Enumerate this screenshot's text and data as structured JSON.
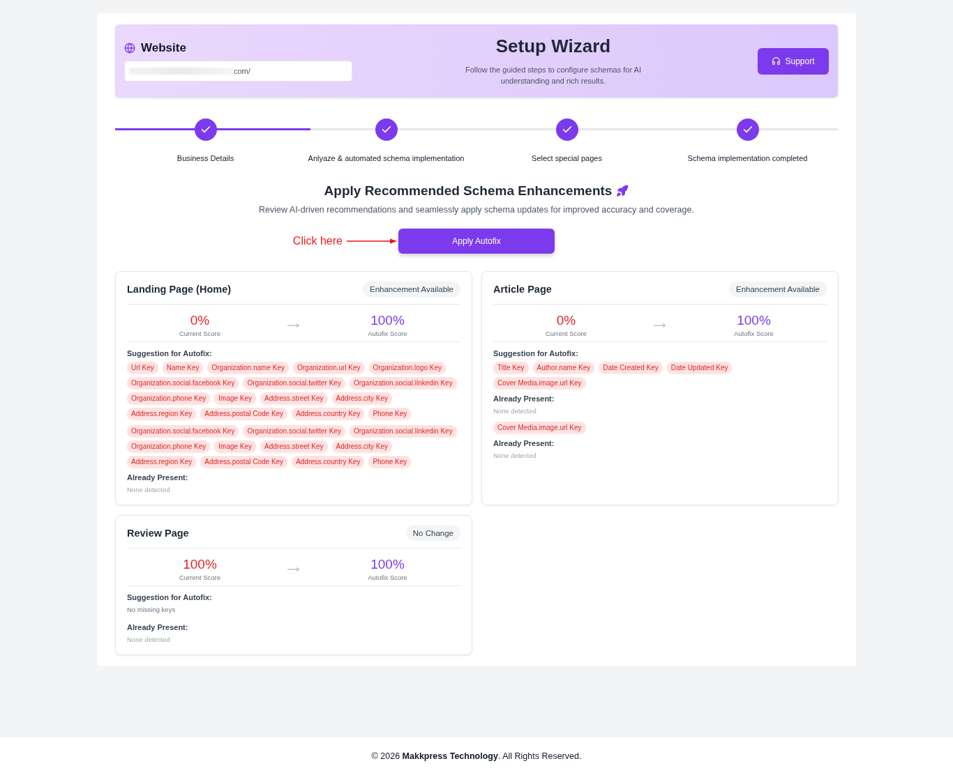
{
  "header": {
    "website_label": "Website",
    "website_value": "com/",
    "title": "Setup Wizard",
    "subtitle": "Follow the guided steps to configure schemas for AI understanding and rich results.",
    "support_button": "Support"
  },
  "progress": {
    "level": 0.27
  },
  "steps": [
    {
      "label": "Business Details",
      "done": true
    },
    {
      "label": "Anlyaze & automated schema implementation",
      "done": true
    },
    {
      "label": "Select special pages",
      "done": true
    },
    {
      "label": "Schema implementation completed",
      "done": true
    }
  ],
  "intro": {
    "title": "Apply Recommended Schema Enhancements",
    "text": "Review AI-driven recommendations and seamlessly apply schema updates for improved accuracy and coverage.",
    "annotation": "Click here",
    "button": "Apply Autofix"
  },
  "cards": [
    {
      "title": "Landing Page (Home)",
      "badge": "Enhancement Available",
      "current_score": "0%",
      "current_label": "Current Score",
      "autofix_score": "100%",
      "autofix_label": "Autofix Score",
      "sections": [
        {
          "kind": "heading",
          "text": "Suggestion for Autofix:"
        },
        {
          "kind": "tags",
          "tags": [
            "Url Key",
            "Name Key",
            "Organization.name Key",
            "Organization.url Key",
            "Organization.logo Key",
            "Organization.social.facebook Key",
            "Organization.social.twitter Key",
            "Organization.social.linkedin Key",
            "Organization.phone Key",
            "Image Key",
            "Address.street Key",
            "Address.city Key",
            "Address.region Key",
            "Address.postal Code Key",
            "Address.country Key",
            "Phone Key"
          ]
        },
        {
          "kind": "tags",
          "tags": [
            "Organization.social.facebook Key",
            "Organization.social.twitter Key",
            "Organization.social.linkedin Key",
            "Organization.phone Key",
            "Image Key",
            "Address.street Key",
            "Address.city Key",
            "Address.region Key",
            "Address.postal Code Key",
            "Address.country Key",
            "Phone Key"
          ]
        },
        {
          "kind": "heading",
          "text": "Already Present:"
        },
        {
          "kind": "note",
          "text": "None detected"
        }
      ]
    },
    {
      "title": "Article Page",
      "badge": "Enhancement Available",
      "current_score": "0%",
      "current_label": "Current Score",
      "autofix_score": "100%",
      "autofix_label": "Autofix Score",
      "sections": [
        {
          "kind": "heading",
          "text": "Suggestion for Autofix:"
        },
        {
          "kind": "tags",
          "tags": [
            "Title Key",
            "Author.name Key",
            "Date Created Key",
            "Date Updated Key",
            "Cover Media.image.url Key"
          ]
        },
        {
          "kind": "heading",
          "text": "Already Present:"
        },
        {
          "kind": "note",
          "text": "None detected"
        },
        {
          "kind": "tags",
          "tags": [
            "Cover Media.image.url Key"
          ]
        },
        {
          "kind": "heading",
          "text": "Already Present:"
        },
        {
          "kind": "note",
          "text": "None detected"
        }
      ]
    },
    {
      "title": "Review Page",
      "badge": "No Change",
      "current_score": "100%",
      "current_label": "Current Score",
      "autofix_score": "100%",
      "autofix_label": "Autofix Score",
      "sections": [
        {
          "kind": "heading",
          "text": "Suggestion for Autofix:"
        },
        {
          "kind": "text",
          "text": "No missing keys"
        },
        {
          "kind": "heading",
          "text": "Already Present:"
        },
        {
          "kind": "note",
          "text": "None detected"
        }
      ]
    }
  ],
  "footer": {
    "text": "© 2026 **Makkpress Technology**. All Rights Reserved."
  }
}
